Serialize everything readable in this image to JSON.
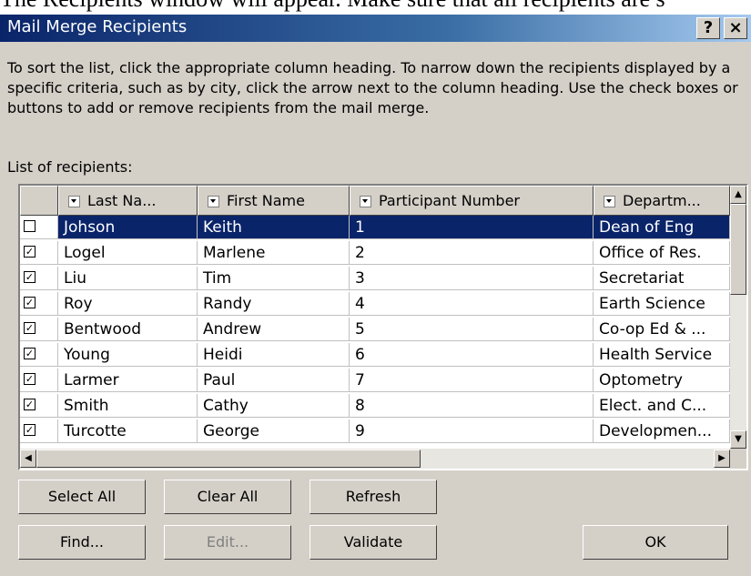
{
  "caption": "The Recipients window will appear. Make sure that all recipients are s",
  "window": {
    "title": "Mail Merge Recipients",
    "help_label": "?",
    "close_label": "×"
  },
  "instructions": "To sort the list, click the appropriate column heading.  To narrow down the recipients displayed by a specific criteria, such as by city, click the arrow next to the column heading.  Use the check boxes or buttons to add or remove recipients from the mail merge.",
  "list_label": "List of recipients:",
  "columns": [
    "Last Na...",
    "First Name",
    "Participant Number",
    "Departm..."
  ],
  "rows": [
    {
      "checked": true,
      "last": "Johson",
      "first": "Keith",
      "number": "1",
      "dept": "Dean of Eng"
    },
    {
      "checked": true,
      "last": "Logel",
      "first": "Marlene",
      "number": "2",
      "dept": "Office of Res."
    },
    {
      "checked": true,
      "last": "Liu",
      "first": "Tim",
      "number": "3",
      "dept": "Secretariat"
    },
    {
      "checked": true,
      "last": "Roy",
      "first": "Randy",
      "number": "4",
      "dept": "Earth Science"
    },
    {
      "checked": true,
      "last": "Bentwood",
      "first": "Andrew",
      "number": "5",
      "dept": "Co-op Ed & ..."
    },
    {
      "checked": true,
      "last": "Young",
      "first": "Heidi",
      "number": "6",
      "dept": "Health Service"
    },
    {
      "checked": true,
      "last": "Larmer",
      "first": "Paul",
      "number": "7",
      "dept": "Optometry"
    },
    {
      "checked": true,
      "last": "Smith",
      "first": "Cathy",
      "number": "8",
      "dept": "Elect. and C..."
    },
    {
      "checked": true,
      "last": "Turcotte",
      "first": "George",
      "number": "9",
      "dept": "Developmen..."
    }
  ],
  "selected_row": 0,
  "buttons": {
    "select_all": "Select All",
    "clear_all": "Clear All",
    "refresh": "Refresh",
    "find": "Find...",
    "edit": "Edit...",
    "validate": "Validate",
    "ok": "OK"
  },
  "colors": {
    "title_bar": "#0a246a",
    "selection": "#0a246a",
    "dialog_bg": "#d4d0c8"
  }
}
